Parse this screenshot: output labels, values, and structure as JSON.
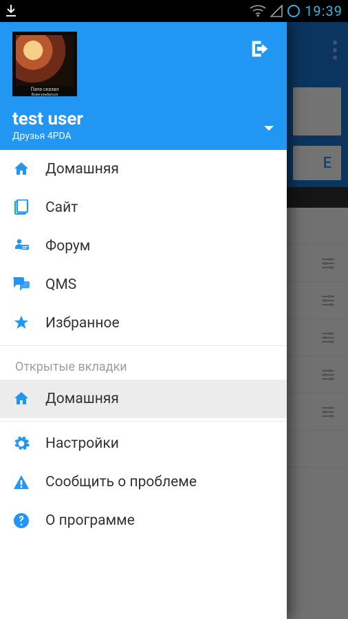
{
  "status": {
    "time": "19:39"
  },
  "drawer": {
    "avatar_caption1": "Папа сказал",
    "avatar_caption2": "Всем улыбаться",
    "user_name": "test user",
    "user_sub": "Друзья 4PDA"
  },
  "menu": {
    "home": "Домашняя",
    "site": "Сайт",
    "forum": "Форум",
    "qms": "QMS",
    "favorites": "Избранное"
  },
  "open_tabs": {
    "title": "Открытые вкладки",
    "items": [
      "Домашняя"
    ]
  },
  "footer": {
    "settings": "Настройки",
    "report": "Сообщить о проблеме",
    "about": "О программе"
  },
  "backdrop": {
    "button_hint": "E"
  },
  "colors": {
    "primary": "#2196F3"
  }
}
